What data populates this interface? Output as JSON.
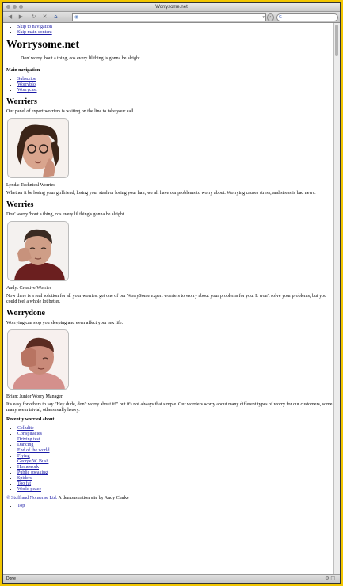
{
  "window": {
    "title": "Worrysome.net"
  },
  "toolbar": {
    "back_glyph": "◀",
    "forward_glyph": "▶",
    "reload_glyph": "↻",
    "stop_glyph": "✕",
    "home_glyph": "⌂",
    "url_value": "",
    "go_glyph": "›"
  },
  "status": {
    "text": "Done"
  },
  "skip_links": [
    "Skip to navigation",
    "Skip main content"
  ],
  "site": {
    "title": "Worrysome.net",
    "tagline": "Don' worry 'bout a thing, cos every lil thing is gonna be alright."
  },
  "main_nav": {
    "heading": "Main navigation",
    "items": [
      "Subscribe",
      "Worryblo",
      "Worrycast"
    ]
  },
  "worriers": {
    "heading": "Worriers",
    "intro": "Our panel of expert worriers is waiting on the line to take your call.",
    "caption": "Lynda: Technical Worries",
    "body": "Whether it be losing your girlfriend, losing your stash or losing your hair, we all have our problems to worry about. Worrying causes stress, and stress is bad news."
  },
  "worries": {
    "heading": "Worries",
    "intro": "Don' worry 'bout a thing, cos every lil thing's gonna be alright",
    "caption": "Andy: Creative Worries",
    "body": "Now there is a real solution for all your worries: get one of our WorrySome expert worriers to worry about your problems for you. It won't solve your problems, but you could feel a whole lot better."
  },
  "worrydone": {
    "heading": "Worrydone",
    "intro": "Worrying can stop you sleeping and even affect your sex life.",
    "caption": "Brian: Junior Worry Manager",
    "body": "It's easy for others to say \"Hey dude, don't worry about it!\" but it's not always that simple. Our worriers worry about many different types of worry for our customers, some many seem trivial, others really heavy."
  },
  "recent": {
    "heading": "Recently worried about",
    "items": [
      "Cellulite",
      "Conspiracies",
      "Driving test",
      "Dancing",
      "End of the world",
      "Flying",
      "George W. Bush",
      "Homework",
      "Public speaking",
      "Spiders",
      "Too fat",
      "World peace"
    ]
  },
  "footer": {
    "copyright_link": "© Stuff and Nonsense Ltd.",
    "credit": " A demonstration site by Andy Clarke",
    "top_link": "Top"
  },
  "colors": {
    "frame_background": "#f2c600",
    "link": "#1a1aa6"
  }
}
